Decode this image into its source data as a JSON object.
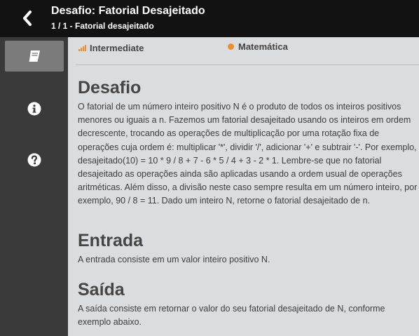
{
  "header": {
    "title": "Desafio: Fatorial Desajeitado",
    "subtitle": "1 / 1 - Fatorial desajeitado"
  },
  "sidebar": {
    "items": [
      {
        "icon": "book-icon",
        "active": true
      },
      {
        "icon": "info-icon",
        "active": false
      },
      {
        "icon": "help-icon",
        "active": false
      }
    ]
  },
  "meta": {
    "level": "Intermediate",
    "subject": "Matemática",
    "accent_color": "#f08c2a"
  },
  "sections": {
    "desafio": {
      "title": "Desafio",
      "body": "O fatorial de um número inteiro positivo N é o produto de todos os inteiros positivos menores ou iguais a n. Fazemos um fatorial desajeitado usando os inteiros em ordem decrescente, trocando as operações de multiplicação por uma rotação fixa de operações cuja ordem é: multiplicar '*', dividir '/', adicionar '+' e subtrair '-'. Por exemplo, desajeitado(10) = 10 * 9 / 8 + 7 - 6 * 5 / 4 + 3 - 2 * 1. Lembre-se que no fatorial desajeitado as operações ainda são aplicadas usando a ordem usual de operações aritméticas. Além disso, a divisão neste caso sempre resulta em um número inteiro, por exemplo, 90 / 8 = 11. Dado um inteiro N, retorne o fatorial desajeitado de n."
    },
    "entrada": {
      "title": "Entrada",
      "body": "A entrada consiste em um valor inteiro positivo N."
    },
    "saida": {
      "title": "Saída",
      "body": "A saída consiste em retornar o valor do seu fatorial desajeitado de N, conforme exemplo abaixo."
    }
  }
}
